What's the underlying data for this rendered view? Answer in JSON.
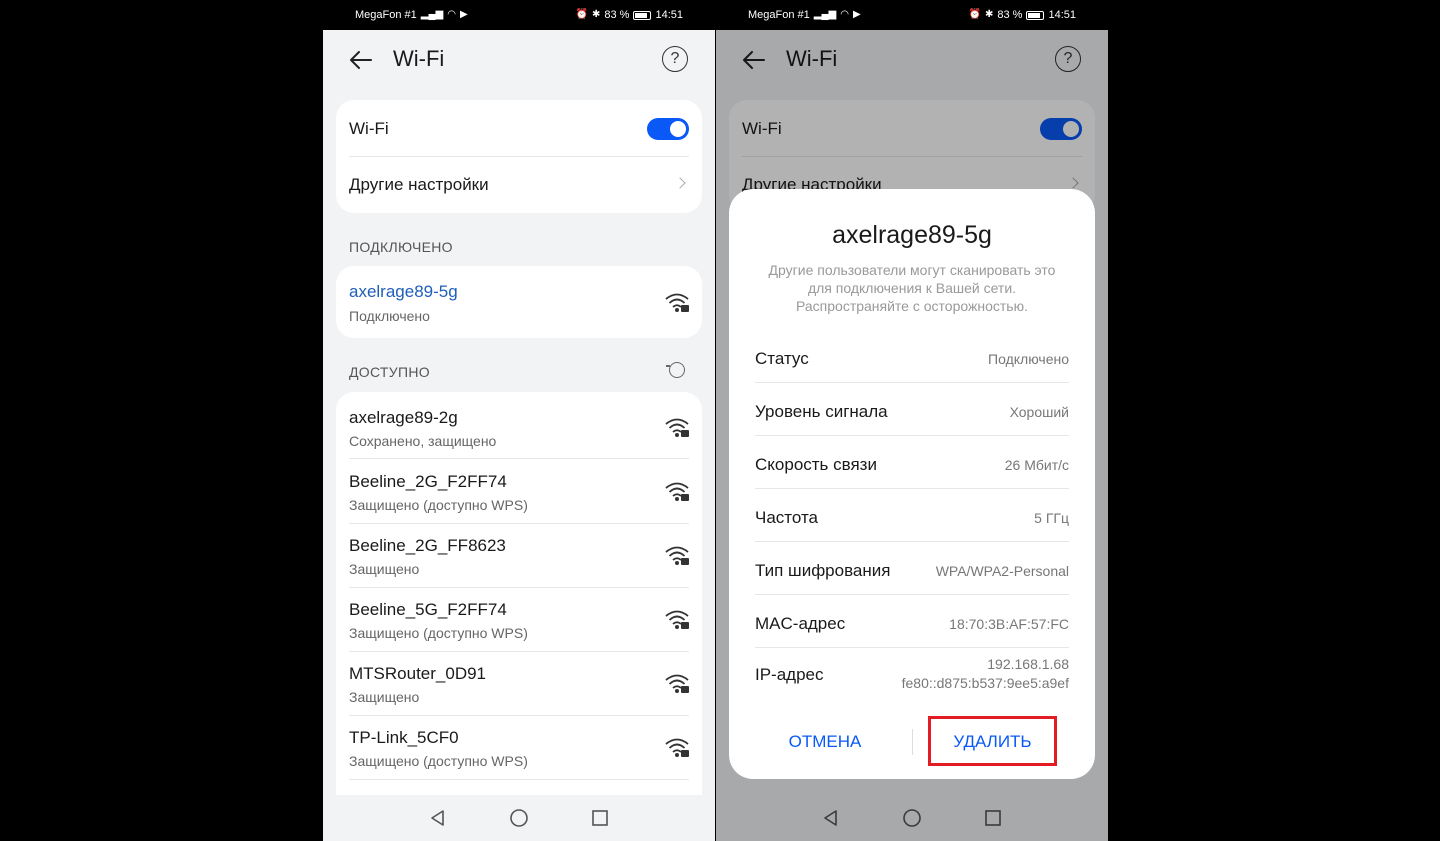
{
  "statusbar": {
    "carrier": "MegaFon #1",
    "battery": "83 %",
    "time": "14:51"
  },
  "header": {
    "title": "Wi-Fi",
    "help_glyph": "?"
  },
  "wifi_card": {
    "wifi_label": "Wi-Fi",
    "wifi_enabled": true,
    "more_settings_label": "Другие настройки"
  },
  "connected_section": {
    "heading": "ПОДКЛЮЧЕНО",
    "network": {
      "name": "axelrage89-5g",
      "status": "Подключено"
    }
  },
  "available_section": {
    "heading": "ДОСТУПНО",
    "networks": [
      {
        "name": "axelrage89-2g",
        "status": "Сохранено, защищено"
      },
      {
        "name": "Beeline_2G_F2FF74",
        "status": "Защищено (доступно WPS)"
      },
      {
        "name": "Beeline_2G_FF8623",
        "status": "Защищено"
      },
      {
        "name": "Beeline_5G_F2FF74",
        "status": "Защищено (доступно WPS)"
      },
      {
        "name": "MTSRouter_0D91",
        "status": "Защищено"
      },
      {
        "name": "TP-Link_5CF0",
        "status": "Защищено (доступно WPS)"
      }
    ]
  },
  "dialog": {
    "title": "axelrage89-5g",
    "message": "Другие пользователи могут сканировать это для подключения к Вашей сети. Распространяйте с осторожностью.",
    "rows": [
      {
        "label": "Статус",
        "value": "Подключено"
      },
      {
        "label": "Уровень сигнала",
        "value": "Хороший"
      },
      {
        "label": "Скорость связи",
        "value": "26 Мбит/с"
      },
      {
        "label": "Частота",
        "value": "5 ГГц"
      },
      {
        "label": "Тип шифрования",
        "value": "WPA/WPA2-Personal"
      },
      {
        "label": "MAC-адрес",
        "value": "18:70:3B:AF:57:FC"
      },
      {
        "label": "IP-адрес",
        "value": "192.168.1.68",
        "value2": "fe80::d875:b537:9ee5:a9ef"
      }
    ],
    "cancel_label": "ОТМЕНА",
    "delete_label": "УДАЛИТЬ"
  },
  "colors": {
    "accent": "#0a59f7",
    "highlight": "#e31b23",
    "connected_name": "#1f5fb8"
  }
}
